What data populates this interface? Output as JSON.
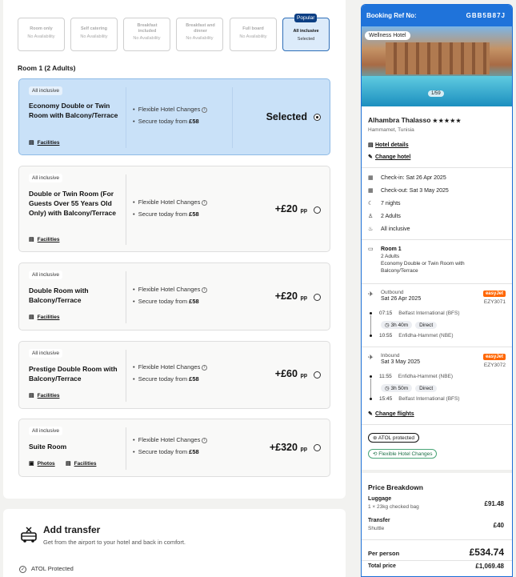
{
  "boards": [
    {
      "name": "Room only",
      "status": "No Availability"
    },
    {
      "name": "Self catering",
      "status": "No Availability"
    },
    {
      "name": "Breakfast included",
      "status": "No Availability"
    },
    {
      "name": "Breakfast and dinner",
      "status": "No Availability"
    },
    {
      "name": "Full board",
      "status": "No Availability"
    },
    {
      "name": "All inclusive",
      "status": "Selected",
      "popular": "Popular"
    }
  ],
  "room_heading": "Room 1 (2 Adults)",
  "rooms": [
    {
      "tag": "All inclusive",
      "name": "Economy Double or Twin Room with Balcony/Terrace",
      "feature1": "Flexible Hotel Changes",
      "feature2_prefix": "Secure today from",
      "feature2_amount": "£58",
      "price": "Selected",
      "facilities": "Facilities"
    },
    {
      "tag": "All inclusive",
      "name": "Double or Twin Room (For Guests Over 55 Years Old Only) with Balcony/Terrace",
      "feature1": "Flexible Hotel Changes",
      "feature2_prefix": "Secure today from",
      "feature2_amount": "£58",
      "price": "+£20",
      "pp": "pp",
      "facilities": "Facilities"
    },
    {
      "tag": "All inclusive",
      "name": "Double Room with Balcony/Terrace",
      "feature1": "Flexible Hotel Changes",
      "feature2_prefix": "Secure today from",
      "feature2_amount": "£58",
      "price": "+£20",
      "pp": "pp",
      "facilities": "Facilities"
    },
    {
      "tag": "All inclusive",
      "name": "Prestige Double Room with Balcony/Terrace",
      "feature1": "Flexible Hotel Changes",
      "feature2_prefix": "Secure today from",
      "feature2_amount": "£58",
      "price": "+£60",
      "pp": "pp",
      "facilities": "Facilities"
    },
    {
      "tag": "All inclusive",
      "name": "Suite Room",
      "feature1": "Flexible Hotel Changes",
      "feature2_prefix": "Secure today from",
      "feature2_amount": "£58",
      "price": "+£320",
      "pp": "pp",
      "photos": "Photos",
      "facilities": "Facilities"
    }
  ],
  "transfer": {
    "title": "Add transfer",
    "subtitle": "Get from the airport to your hotel and back in comfort.",
    "atol": "ATOL Protected"
  },
  "booking": {
    "ref_label": "Booking Ref No:",
    "ref": "GBB5B87J",
    "photo_tag": "Wellness Hotel",
    "photo_count": "1/59",
    "hotel_name": "Alhambra Thalasso",
    "stars": "★★★★★",
    "location": "Hammamet, Tunisia",
    "hotel_details": "Hotel details",
    "change_hotel": "Change hotel",
    "checkin": "Check-in: Sat 26 Apr 2025",
    "checkout": "Check-out: Sat 3 May 2025",
    "nights": "7 nights",
    "adults": "2 Adults",
    "board": "All inclusive",
    "room_label": "Room 1",
    "room_adults": "2 Adults",
    "room_type": "Economy Double or Twin Room with Balcony/Terrace",
    "outbound": {
      "label": "Outbound",
      "date": "Sat 26 Apr 2025",
      "airline": "easyJet",
      "code": "EZY3071",
      "dep_time": "07:15",
      "dep_airport": "Belfast International (BFS)",
      "duration": "3h 40m",
      "direct": "Direct",
      "arr_time": "10:55",
      "arr_airport": "Enfidha-Hammet (NBE)"
    },
    "inbound": {
      "label": "Inbound",
      "date": "Sat 3 May 2025",
      "airline": "easyJet",
      "code": "EZY3072",
      "dep_time": "11:55",
      "dep_airport": "Enfidha-Hammet (NBE)",
      "duration": "3h 50m",
      "direct": "Direct",
      "arr_time": "15:45",
      "arr_airport": "Belfast International (BFS)"
    },
    "change_flights": "Change flights",
    "atol_badge": "ATOL protected",
    "flex_badge": "Flexible Hotel Changes"
  },
  "price_breakdown": {
    "title": "Price Breakdown",
    "luggage_label": "Luggage",
    "luggage_sub": "1 × 23kg checked bag",
    "luggage_value": "£91.48",
    "transfer_label": "Transfer",
    "transfer_sub": "Shuttle",
    "transfer_value": "£40",
    "per_person_label": "Per person",
    "per_person_value": "£534.74",
    "total_label": "Total price",
    "total_value": "£1,069.48"
  },
  "colors": {
    "accent": "#1f73da",
    "selected_bg": "#c9e1f8",
    "easyjet": "#ff6600",
    "dark_blue": "#0c3f84"
  }
}
